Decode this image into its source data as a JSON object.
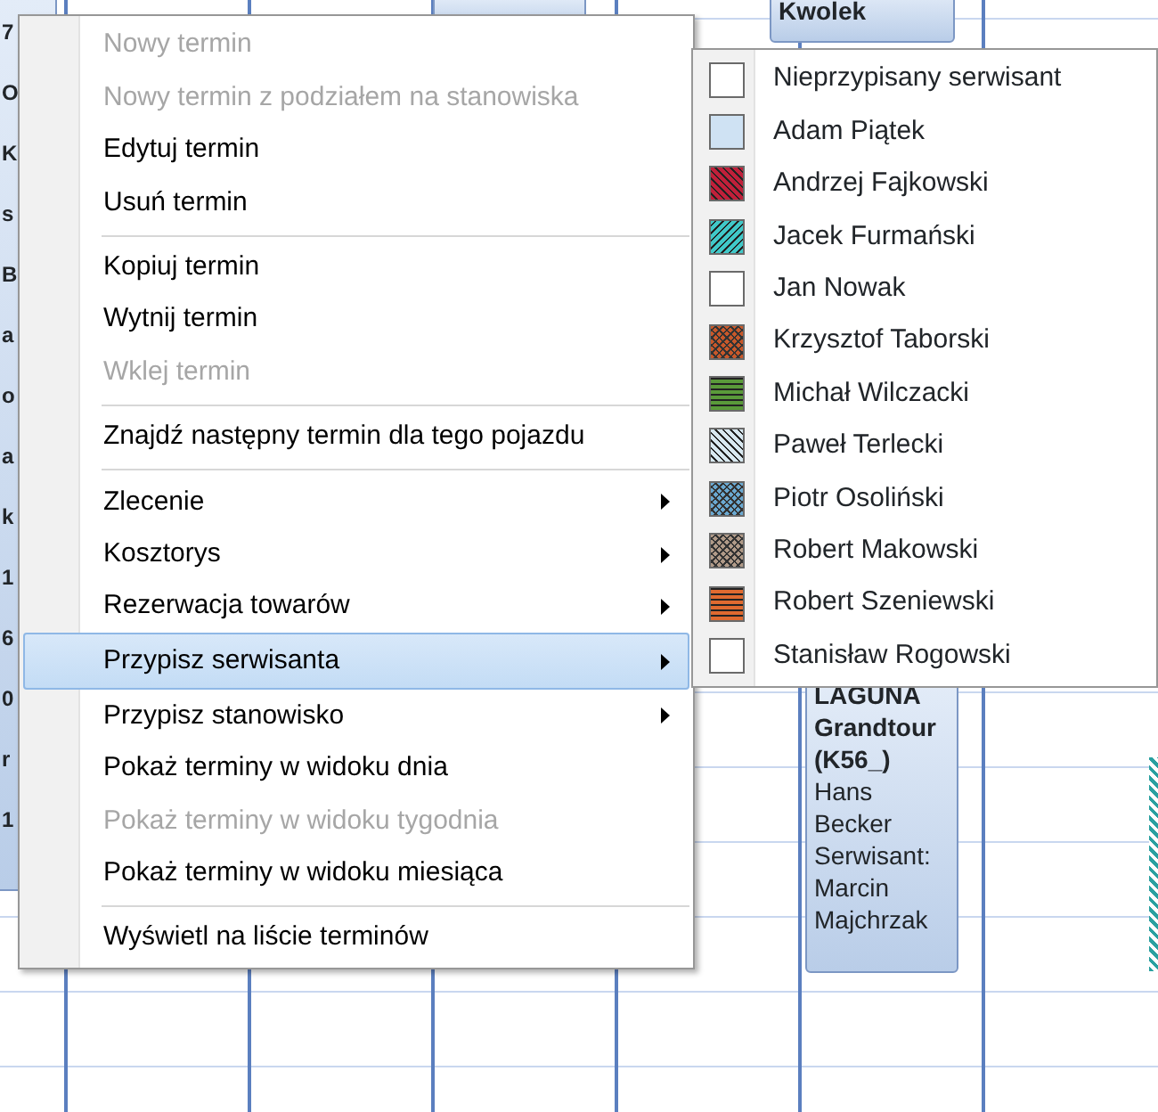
{
  "calendar": {
    "appointments": [
      {
        "lines": [
          "7",
          "O",
          "K",
          "s",
          "B",
          "a",
          "o",
          "a",
          "k",
          "1",
          "6",
          "0",
          "r",
          "1"
        ]
      },
      {
        "lines": [
          "Kwolek"
        ]
      },
      {
        "lines": [
          "LAGUNA",
          "Grandtour",
          "(K56_)",
          "Hans",
          "Becker",
          "Serwisant:",
          "Marcin",
          "Majchrzak"
        ]
      }
    ]
  },
  "context_menu": {
    "items": [
      {
        "kind": "item",
        "label": "Nowy termin",
        "disabled": true,
        "submenu": false,
        "selected": false
      },
      {
        "kind": "item",
        "label": "Nowy termin z podziałem na stanowiska",
        "disabled": true,
        "submenu": false,
        "selected": false
      },
      {
        "kind": "item",
        "label": "Edytuj termin",
        "disabled": false,
        "submenu": false,
        "selected": false
      },
      {
        "kind": "item",
        "label": "Usuń termin",
        "disabled": false,
        "submenu": false,
        "selected": false
      },
      {
        "kind": "separator"
      },
      {
        "kind": "item",
        "label": "Kopiuj termin",
        "disabled": false,
        "submenu": false,
        "selected": false
      },
      {
        "kind": "item",
        "label": "Wytnij termin",
        "disabled": false,
        "submenu": false,
        "selected": false
      },
      {
        "kind": "item",
        "label": "Wklej termin",
        "disabled": true,
        "submenu": false,
        "selected": false
      },
      {
        "kind": "separator"
      },
      {
        "kind": "item",
        "label": "Znajdź następny termin dla tego pojazdu",
        "disabled": false,
        "submenu": false,
        "selected": false
      },
      {
        "kind": "separator"
      },
      {
        "kind": "item",
        "label": "Zlecenie",
        "disabled": false,
        "submenu": true,
        "selected": false
      },
      {
        "kind": "item",
        "label": "Kosztorys",
        "disabled": false,
        "submenu": true,
        "selected": false
      },
      {
        "kind": "item",
        "label": "Rezerwacja towarów",
        "disabled": false,
        "submenu": true,
        "selected": false
      },
      {
        "kind": "item",
        "label": "Przypisz serwisanta",
        "disabled": false,
        "submenu": true,
        "selected": true
      },
      {
        "kind": "item",
        "label": "Przypisz stanowisko",
        "disabled": false,
        "submenu": true,
        "selected": false
      },
      {
        "kind": "item",
        "label": "Pokaż terminy w widoku dnia",
        "disabled": false,
        "submenu": false,
        "selected": false
      },
      {
        "kind": "item",
        "label": "Pokaż terminy w widoku tygodnia",
        "disabled": true,
        "submenu": false,
        "selected": false
      },
      {
        "kind": "item",
        "label": "Pokaż terminy w widoku miesiąca",
        "disabled": false,
        "submenu": false,
        "selected": false
      },
      {
        "kind": "separator"
      },
      {
        "kind": "item",
        "label": "Wyświetl na liście terminów",
        "disabled": false,
        "submenu": false,
        "selected": false
      }
    ]
  },
  "submenu": {
    "items": [
      {
        "label": "Nieprzypisany serwisant",
        "color": "#ffffff",
        "kind": "solid"
      },
      {
        "label": "Adam Piątek",
        "color": "#cfe2f3",
        "kind": "solid"
      },
      {
        "label": "Andrzej Fajkowski",
        "color": "#c0203a",
        "kind": "diagonal"
      },
      {
        "label": "Jacek Furmański",
        "color": "#40c8c8",
        "kind": "diagonal-back"
      },
      {
        "label": "Jan Nowak",
        "color": "#ffffff",
        "kind": "solid"
      },
      {
        "label": "Krzysztof Taborski",
        "color": "#c8582a",
        "kind": "dots"
      },
      {
        "label": "Michał Wilczacki",
        "color": "#5a9a3a",
        "kind": "horizontal"
      },
      {
        "label": "Paweł Terlecki",
        "color": "#d8e8f0",
        "kind": "diagonal"
      },
      {
        "label": "Piotr Osoliński",
        "color": "#6aa8d0",
        "kind": "dots"
      },
      {
        "label": "Robert Makowski",
        "color": "#b09a88",
        "kind": "dots"
      },
      {
        "label": "Robert Szeniewski",
        "color": "#e06a30",
        "kind": "horizontal"
      },
      {
        "label": "Stanisław Rogowski",
        "color": "#ffffff",
        "kind": "solid"
      }
    ]
  }
}
